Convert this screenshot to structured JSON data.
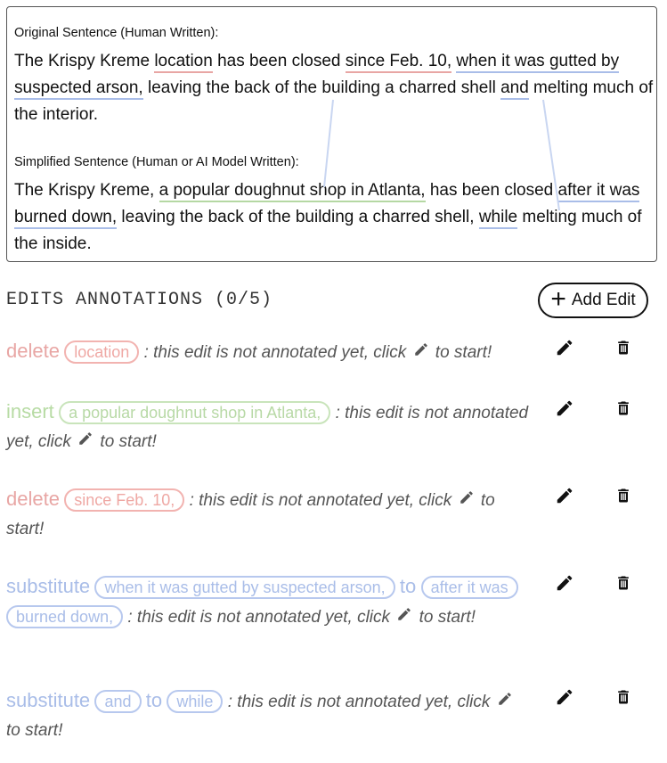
{
  "original": {
    "label": "Original Sentence (Human Written):",
    "segments": [
      "The Krispy Kreme ",
      "location",
      " has been closed ",
      "since Feb. 10,",
      " ",
      "when it was gutted by suspected arson,",
      " leaving the back of the building a charred shell ",
      "and",
      " melting much of the interior."
    ]
  },
  "simplified": {
    "label": "Simplified Sentence (Human or AI Model Written):",
    "segments": [
      "The Krispy Kreme, ",
      "a popular doughnut shop in Atlanta,",
      " has been closed ",
      "after it was burned down,",
      " leaving the back of the building a charred shell, ",
      "while",
      " melting much of the inside."
    ]
  },
  "edits_title": "EDITS ANNOTATIONS (0/5)",
  "add_edit_label": "Add Edit",
  "edits": [
    {
      "type": "delete",
      "a": "location",
      "note": ": this edit is not annotated yet, click",
      "note_end": "to start!"
    },
    {
      "type": "insert",
      "a": "a popular doughnut shop in Atlanta,",
      "note": ": this edit is not annotated yet, click",
      "note_end": "to start!"
    },
    {
      "type": "delete",
      "a": "since Feb. 10,",
      "note": ": this edit is not annotated yet, click",
      "note_end": "to start!"
    },
    {
      "type": "substitute",
      "a": "when it was gutted by suspected arson,",
      "to": "to",
      "b": "after it was burned down,",
      "note": ": this edit is not annotated yet, click",
      "note_end": "to start!"
    },
    {
      "type": "substitute",
      "a": "and",
      "to": "to",
      "b": "while",
      "note": ": this edit is not annotated yet, click",
      "note_end": "to start!"
    }
  ],
  "colors": {
    "delete": "#e8a6a4",
    "insert": "#b7dba4",
    "substitute": "#a9bde8"
  },
  "icons": {
    "edit": "pencil-icon",
    "remove": "trash-icon",
    "add": "plus-icon"
  }
}
